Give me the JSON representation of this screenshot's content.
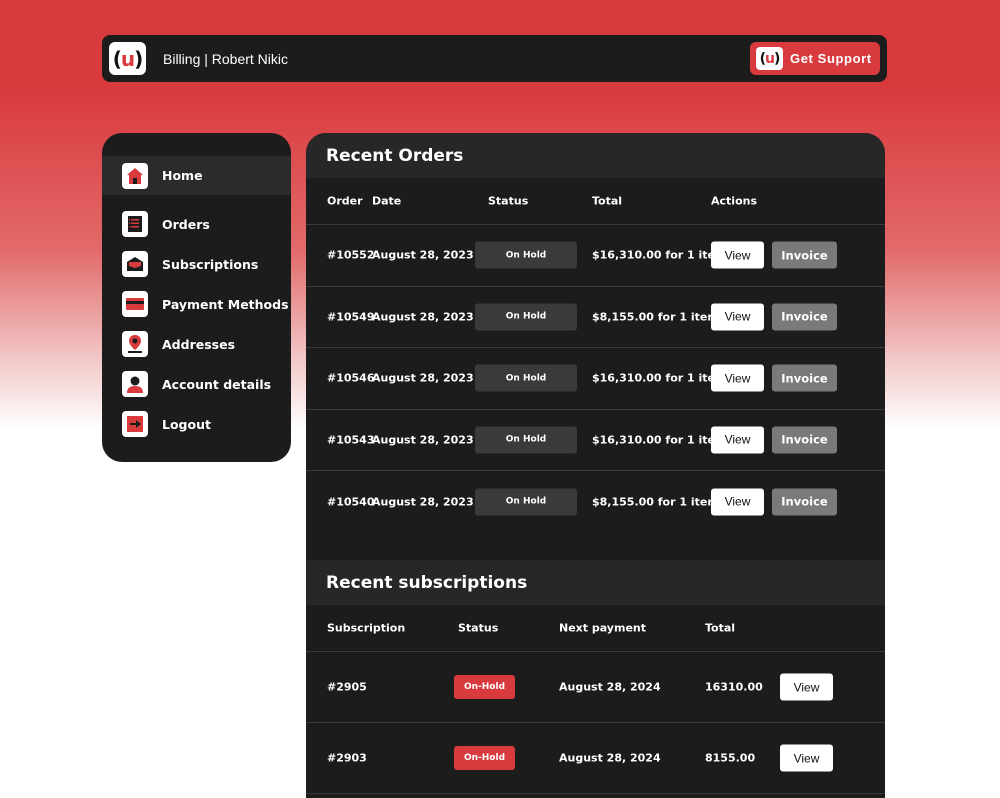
{
  "header": {
    "logo_text": "(u)",
    "title": "Billing | Robert Nikic",
    "support_label": "Get Support"
  },
  "sidebar": {
    "items": [
      {
        "label": "Home",
        "icon": "home-icon",
        "active": true
      },
      {
        "label": "Orders",
        "icon": "orders-icon",
        "active": false
      },
      {
        "label": "Subscriptions",
        "icon": "subscriptions-icon",
        "active": false
      },
      {
        "label": "Payment Methods",
        "icon": "payment-card-icon",
        "active": false
      },
      {
        "label": "Addresses",
        "icon": "map-pin-icon",
        "active": false
      },
      {
        "label": "Account details",
        "icon": "user-icon",
        "active": false
      },
      {
        "label": "Logout",
        "icon": "logout-icon",
        "active": false
      }
    ]
  },
  "orders": {
    "title": "Recent Orders",
    "columns": {
      "order": "Order",
      "date": "Date",
      "status": "Status",
      "total": "Total",
      "actions": "Actions"
    },
    "rows": [
      {
        "order": "#10552",
        "date": "August 28, 2023",
        "status": "On Hold",
        "total": "$16,310.00 for 1 item",
        "view": "View",
        "invoice": "Invoice"
      },
      {
        "order": "#10549",
        "date": "August 28, 2023",
        "status": "On Hold",
        "total": "$8,155.00 for 1 item",
        "view": "View",
        "invoice": "Invoice"
      },
      {
        "order": "#10546",
        "date": "August 28, 2023",
        "status": "On Hold",
        "total": "$16,310.00 for 1 item",
        "view": "View",
        "invoice": "Invoice"
      },
      {
        "order": "#10543",
        "date": "August 28, 2023",
        "status": "On Hold",
        "total": "$16,310.00 for 1 item",
        "view": "View",
        "invoice": "Invoice"
      },
      {
        "order": "#10540",
        "date": "August 28, 2023",
        "status": "On Hold",
        "total": "$8,155.00 for 1 item",
        "view": "View",
        "invoice": "Invoice"
      }
    ]
  },
  "subscriptions": {
    "title": "Recent subscriptions",
    "columns": {
      "subscription": "Subscription",
      "status": "Status",
      "next_payment": "Next payment",
      "total": "Total"
    },
    "rows": [
      {
        "subscription": "#2905",
        "status": "On-Hold",
        "next_payment": "August 28, 2024",
        "total": "16310.00",
        "view": "View"
      },
      {
        "subscription": "#2903",
        "status": "On-Hold",
        "next_payment": "August 28, 2024",
        "total": "8155.00",
        "view": "View"
      }
    ]
  },
  "colors": {
    "accent": "#d93a3e",
    "panel": "#1c1c1c",
    "panel_header": "#272727",
    "badge_gray": "#3a3a3a",
    "invoice_button": "#7a7a7a"
  }
}
